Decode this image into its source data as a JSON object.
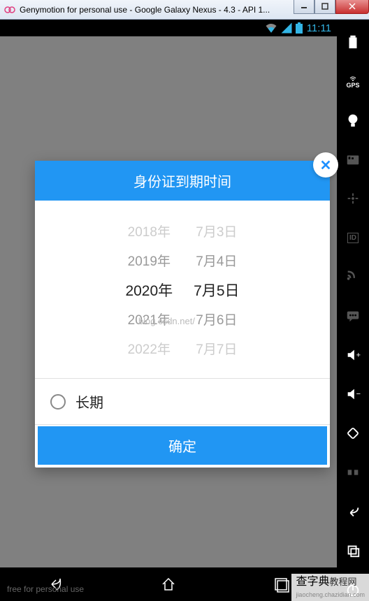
{
  "window": {
    "title": "Genymotion for personal use - Google Galaxy Nexus - 4.3 - API 1..."
  },
  "status_bar": {
    "time": "11:11"
  },
  "sidebar": {
    "gps_label": "GPS",
    "id_label": "ID"
  },
  "modal": {
    "title": "身份证到期时间",
    "year_wheel": [
      "2018年",
      "2019年",
      "2020年",
      "2021年",
      "2022年"
    ],
    "date_wheel": [
      "7月3日",
      "7月4日",
      "7月5日",
      "7月6日",
      "7月7日"
    ],
    "selected_year_index": 2,
    "selected_date_index": 2,
    "permanent_label": "长期",
    "confirm_label": "确定",
    "watermark_url": "blog.csdn.net/"
  },
  "footer": {
    "free_text": "free for personal use"
  },
  "site_watermark": {
    "main": "查字典",
    "sub": "教程网",
    "url": "jiaocheng.chazidian.com"
  }
}
